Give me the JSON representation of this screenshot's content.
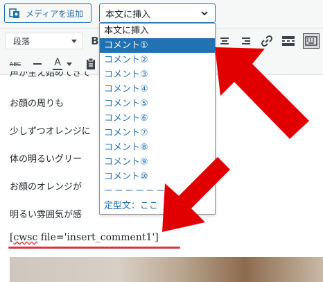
{
  "toolbar_top": {
    "media_button_label": "メディアを追加",
    "insert_select_value": "本文に挿入"
  },
  "editor_toolbar": {
    "paragraph_select_value": "段落"
  },
  "dropdown": {
    "options": [
      "本文に挿入",
      "コメント①",
      "コメント②",
      "コメント③",
      "コメント④",
      "コメント⑤",
      "コメント⑥",
      "コメント⑦",
      "コメント⑧",
      "コメント⑨",
      "コメント⑩",
      "－－－－－－",
      "定型文：ここ"
    ],
    "selected_index": 1
  },
  "content": {
    "paragraphs": [
      "お顔の周りも",
      "少しずつオレンジに",
      "体の明るいグリー",
      "お顔のオレンジが",
      "明るい雰囲気が感"
    ],
    "shortcode_prefix": "[",
    "shortcode_squiggle": "cwsc",
    "shortcode_rest": " file='insert_comment1']"
  },
  "colors": {
    "accent": "#2271b1",
    "arrow": "#e00000",
    "underline": "#d63638"
  }
}
